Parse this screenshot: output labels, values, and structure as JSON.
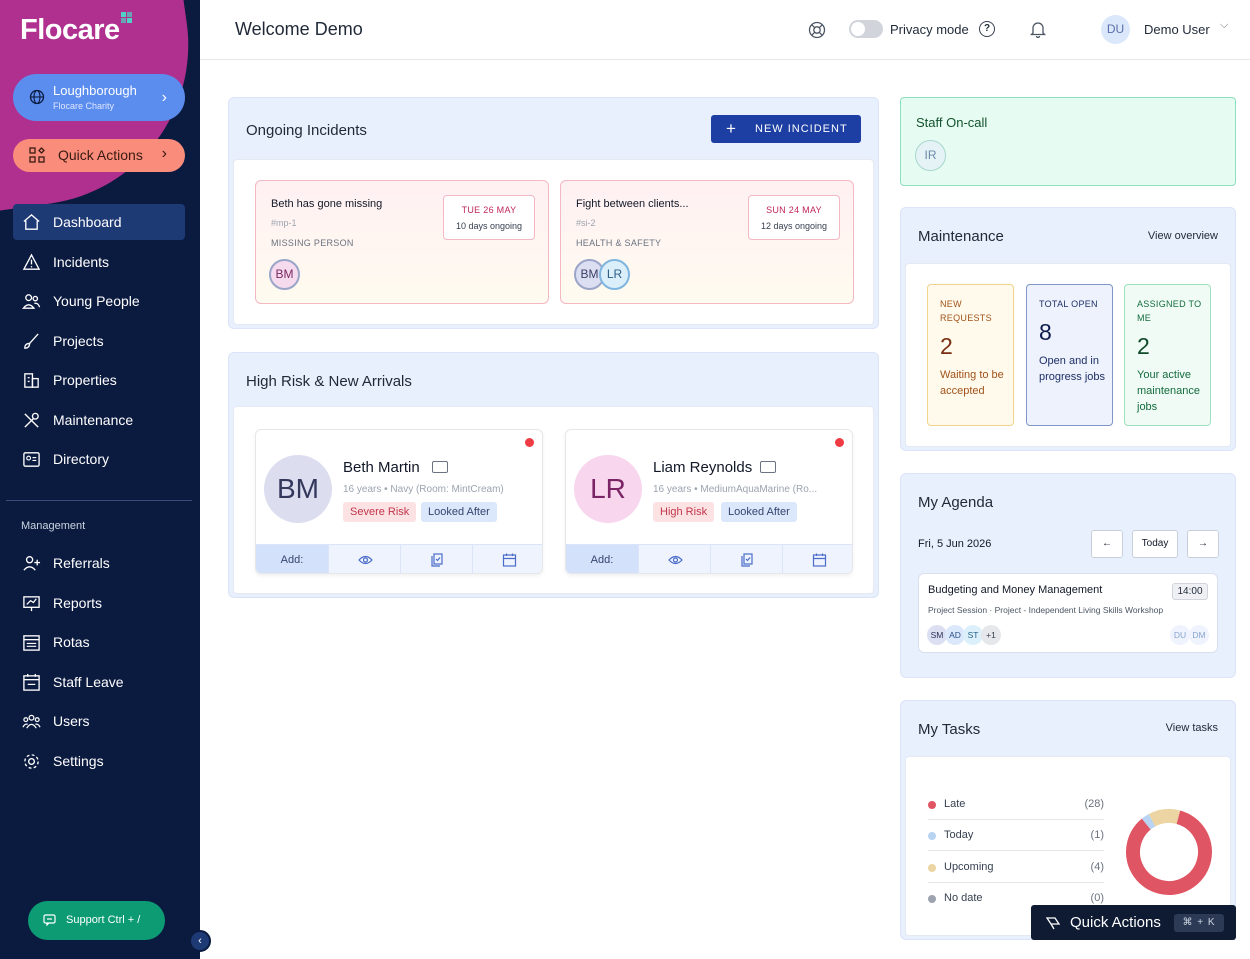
{
  "app": {
    "logo": "Flocare"
  },
  "sidebar": {
    "org": {
      "name": "Loughborough",
      "sub": "Flocare Charity"
    },
    "quick_actions": "Quick Actions",
    "nav": [
      {
        "label": "Dashboard",
        "icon": "home-icon"
      },
      {
        "label": "Incidents",
        "icon": "warning-icon"
      },
      {
        "label": "Young People",
        "icon": "people-icon"
      },
      {
        "label": "Projects",
        "icon": "brush-icon"
      },
      {
        "label": "Properties",
        "icon": "building-icon"
      },
      {
        "label": "Maintenance",
        "icon": "tools-icon"
      },
      {
        "label": "Directory",
        "icon": "contact-card-icon"
      }
    ],
    "management_label": "Management",
    "management_nav": [
      {
        "label": "Referrals",
        "icon": "add-person-icon"
      },
      {
        "label": "Reports",
        "icon": "presentation-chart-icon"
      },
      {
        "label": "Rotas",
        "icon": "calendar-grid-icon"
      },
      {
        "label": "Staff Leave",
        "icon": "calendar-leave-icon"
      },
      {
        "label": "Users",
        "icon": "users-group-icon"
      },
      {
        "label": "Settings",
        "icon": "gear-icon"
      }
    ],
    "support": "Support  Ctrl + /"
  },
  "header": {
    "title": "Welcome Demo",
    "privacy_label": "Privacy mode",
    "help": "?",
    "user_initials": "DU",
    "user_name": "Demo User",
    "user_chev": "⌵"
  },
  "incidents": {
    "title": "Ongoing Incidents",
    "new_button": "NEW INCIDENT",
    "cards": [
      {
        "title": "Beth has gone missing",
        "code": "#mp-1",
        "type": "MISSING PERSON",
        "date": "TUE 26 MAY",
        "duration": "10 days ongoing",
        "avatars": [
          "BM"
        ]
      },
      {
        "title": "Fight between clients...",
        "code": "#si-2",
        "type": "HEALTH & SAFETY",
        "date": "SUN 24 MAY",
        "duration": "12 days ongoing",
        "avatars": [
          "BM",
          "LR"
        ]
      }
    ]
  },
  "high_risk": {
    "title": "High Risk & New Arrivals",
    "add_label": "Add:",
    "people": [
      {
        "initials": "BM",
        "name": "Beth Martin",
        "meta": "16 years  •  Navy (Room: MintCream)",
        "risk": "Severe Risk",
        "status": "Looked After"
      },
      {
        "initials": "LR",
        "name": "Liam Reynolds",
        "meta": "16 years  •  MediumAquaMarine (Ro...",
        "risk": "High Risk",
        "status": "Looked After"
      }
    ]
  },
  "oncall": {
    "title": "Staff On-call",
    "avatar": "IR"
  },
  "maintenance": {
    "title": "Maintenance",
    "link": "View overview",
    "boxes": [
      {
        "heading": "NEW REQUESTS",
        "value": "2",
        "desc": "Waiting to be accepted"
      },
      {
        "heading": "TOTAL OPEN",
        "value": "8",
        "desc": "Open and in progress jobs"
      },
      {
        "heading": "ASSIGNED TO ME",
        "value": "2",
        "desc": "Your active maintenance jobs"
      }
    ]
  },
  "agenda": {
    "title": "My Agenda",
    "date": "Fri, 5 Jun 2026",
    "prev": "←",
    "today": "Today",
    "next": "→",
    "event": {
      "title": "Budgeting and Money Management",
      "time": "14:00",
      "sub": "Project Session · Project - Independent Living Skills Workshop",
      "attendees": [
        "SM",
        "AD",
        "ST",
        "+1"
      ],
      "owners": [
        "DU",
        "DM"
      ]
    }
  },
  "tasks": {
    "title": "My Tasks",
    "link": "View tasks",
    "rows": [
      {
        "label": "Late",
        "count": "(28)",
        "color": "#e05563"
      },
      {
        "label": "Today",
        "count": "(1)",
        "color": "#b8d4f2"
      },
      {
        "label": "Upcoming",
        "count": "(4)",
        "color": "#ecd5a3"
      },
      {
        "label": "No date",
        "count": "(0)",
        "color": "#9ca3af"
      }
    ]
  },
  "chart_data": {
    "type": "pie",
    "categories": [
      "Late",
      "Today",
      "Upcoming",
      "No date"
    ],
    "values": [
      28,
      1,
      4,
      0
    ],
    "colors": [
      "#e05563",
      "#b8d4f2",
      "#ecd5a3",
      "#9ca3af"
    ]
  },
  "quick_float": {
    "label": "Quick Actions",
    "kbd": "⌘ + K"
  }
}
